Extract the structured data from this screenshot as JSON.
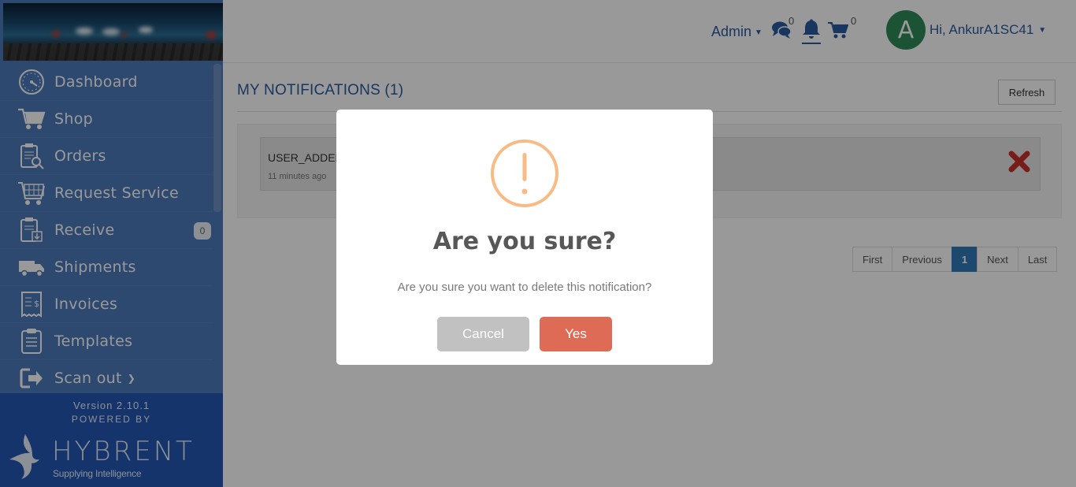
{
  "sidebar": {
    "items": [
      {
        "label": "Dashboard",
        "icon": "dashboard-gauge-icon"
      },
      {
        "label": "Shop",
        "icon": "shopping-cart-icon"
      },
      {
        "label": "Orders",
        "icon": "orders-clipboard-search-icon"
      },
      {
        "label": "Request Service",
        "icon": "service-cart-icon"
      },
      {
        "label": "Receive",
        "icon": "receive-clipboard-icon",
        "badge": "0"
      },
      {
        "label": "Shipments",
        "icon": "delivery-truck-icon"
      },
      {
        "label": "Invoices",
        "icon": "invoice-receipt-icon"
      },
      {
        "label": "Templates",
        "icon": "template-clipboard-icon"
      },
      {
        "label": "Scan out",
        "icon": "sign-out-icon"
      }
    ],
    "version": "Version 2.10.1",
    "powered_by": "POWERED BY",
    "logo_text": "HYBRENT",
    "logo_tagline": "Supplying Intelligence"
  },
  "header": {
    "admin_label": "Admin",
    "messages_count": "0",
    "cart_count": "0",
    "avatar_letter": "A",
    "user_greeting": "Hi, AnkurA1SC41"
  },
  "main": {
    "title": "MY NOTIFICATIONS (1)",
    "refresh_label": "Refresh",
    "notification": {
      "title": "USER_ADDED",
      "time": "11 minutes ago"
    },
    "pagination": [
      "First",
      "Previous",
      "1",
      "Next",
      "Last"
    ],
    "active_page": "1"
  },
  "modal": {
    "title": "Are you sure?",
    "text": "Are you sure you want to delete this notification?",
    "cancel_label": "Cancel",
    "confirm_label": "Yes"
  },
  "colors": {
    "sidebar": "#4d7ab9",
    "brand_blue": "#2b5aa0",
    "warning": "#f8bb86",
    "confirm": "#dd6b55",
    "cancel": "#c1c1c1",
    "delete": "#c9302c",
    "avatar": "#2e8a57"
  }
}
